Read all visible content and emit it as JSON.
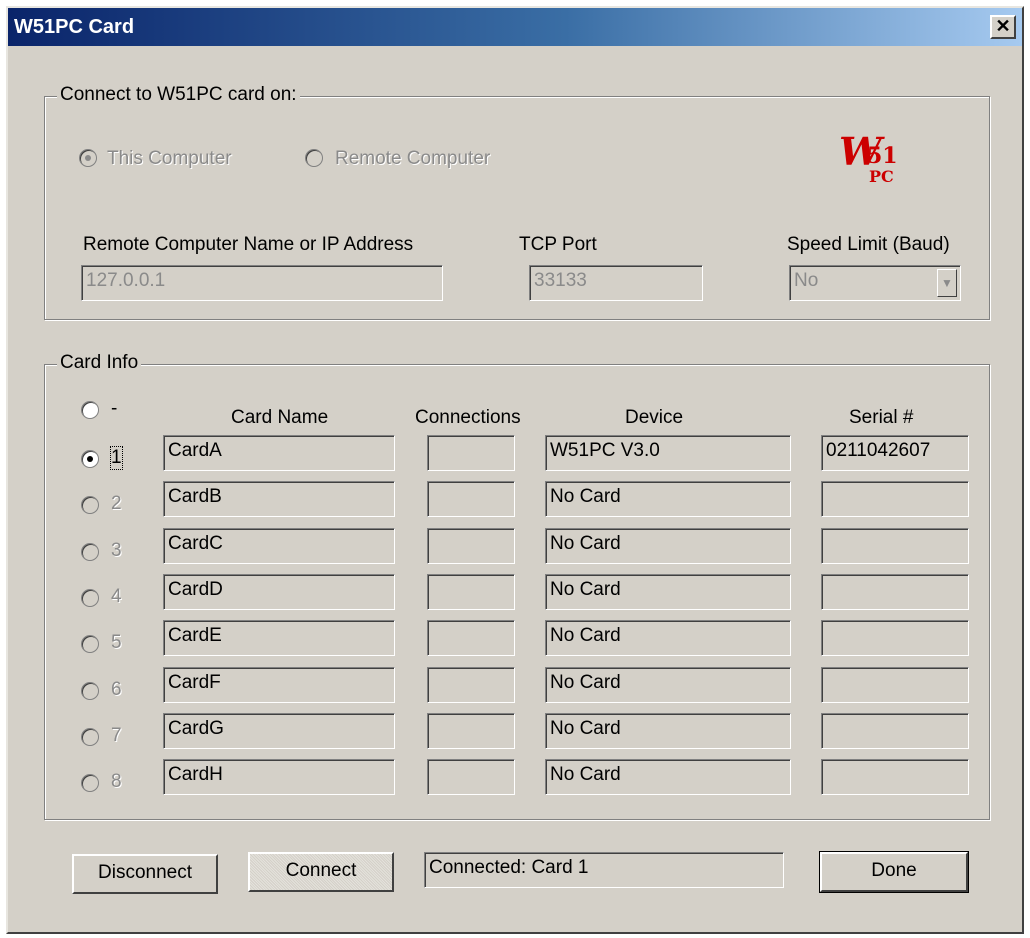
{
  "window": {
    "title": "W51PC Card",
    "close": "✕"
  },
  "connect_group": {
    "label": "Connect to W51PC card on:",
    "radio_this": "This Computer",
    "radio_remote": "Remote Computer",
    "logo_w": "W",
    "logo_51": "51",
    "logo_pc": "PC",
    "remote_name_label": "Remote Computer Name or IP Address",
    "remote_name_value": "127.0.0.1",
    "tcp_port_label": "TCP Port",
    "tcp_port_value": "33133",
    "speed_limit_label": "Speed Limit (Baud)",
    "speed_limit_value": "No"
  },
  "card_info": {
    "label": "Card Info",
    "none_label": "-",
    "headers": {
      "name": "Card Name",
      "connections": "Connections",
      "device": "Device",
      "serial": "Serial #"
    },
    "rows": [
      {
        "num": "1",
        "name": "CardA",
        "connections": "",
        "device": "W51PC V3.0",
        "serial": "0211042607"
      },
      {
        "num": "2",
        "name": "CardB",
        "connections": "",
        "device": "No Card",
        "serial": ""
      },
      {
        "num": "3",
        "name": "CardC",
        "connections": "",
        "device": "No Card",
        "serial": ""
      },
      {
        "num": "4",
        "name": "CardD",
        "connections": "",
        "device": "No Card",
        "serial": ""
      },
      {
        "num": "5",
        "name": "CardE",
        "connections": "",
        "device": "No Card",
        "serial": ""
      },
      {
        "num": "6",
        "name": "CardF",
        "connections": "",
        "device": "No Card",
        "serial": ""
      },
      {
        "num": "7",
        "name": "CardG",
        "connections": "",
        "device": "No Card",
        "serial": ""
      },
      {
        "num": "8",
        "name": "CardH",
        "connections": "",
        "device": "No Card",
        "serial": ""
      }
    ]
  },
  "footer": {
    "disconnect": "Disconnect",
    "connect": "Connect",
    "status": "Connected: Card 1",
    "done": "Done"
  }
}
